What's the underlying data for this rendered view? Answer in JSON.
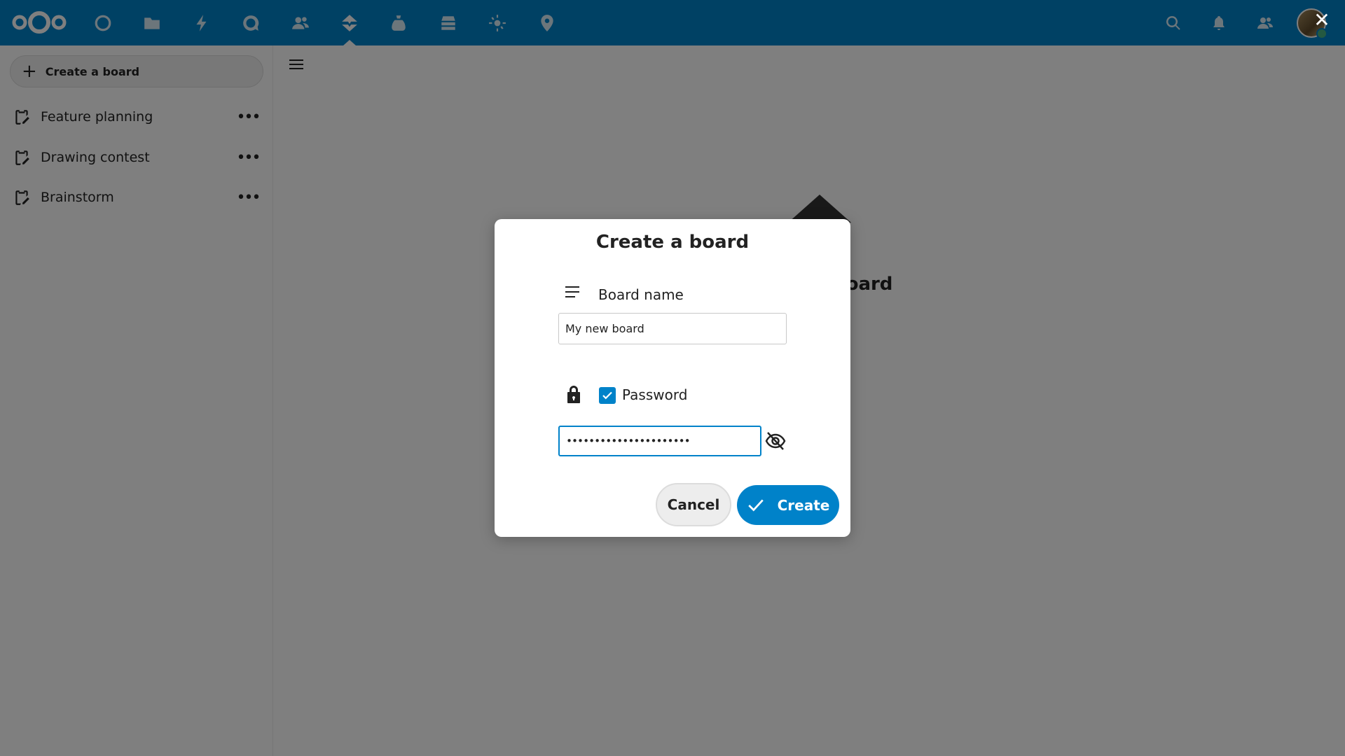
{
  "header": {
    "apps": [
      {
        "name": "dashboard-icon"
      },
      {
        "name": "files-icon"
      },
      {
        "name": "activity-icon"
      },
      {
        "name": "talk-icon"
      },
      {
        "name": "contacts-icon"
      },
      {
        "name": "deck-icon",
        "active": true
      },
      {
        "name": "cospend-icon"
      },
      {
        "name": "tables-icon"
      },
      {
        "name": "weather-icon"
      },
      {
        "name": "maps-icon"
      }
    ],
    "right": [
      "search-icon",
      "notifications-icon",
      "contacts-menu-icon"
    ],
    "close_glyph": "✕"
  },
  "sidebar": {
    "new_board_plus": "+",
    "new_board_label": "Create a board",
    "boards": [
      {
        "label": "Feature planning",
        "actions": "•••"
      },
      {
        "label": "Drawing contest",
        "actions": "•••"
      },
      {
        "label": "Brainstorm",
        "actions": "•••"
      }
    ]
  },
  "main": {
    "empty_title": "oard"
  },
  "modal": {
    "title": "Create a board",
    "name_label": "Board name",
    "name_value": "My new board",
    "password_checked": true,
    "password_label": "Password",
    "password_value": "••••••••••••••••••••••",
    "cancel_label": "Cancel",
    "create_label": "Create"
  },
  "colors": {
    "primary": "#0082c9",
    "overlay": "rgba(0,0,0,0.5)"
  }
}
